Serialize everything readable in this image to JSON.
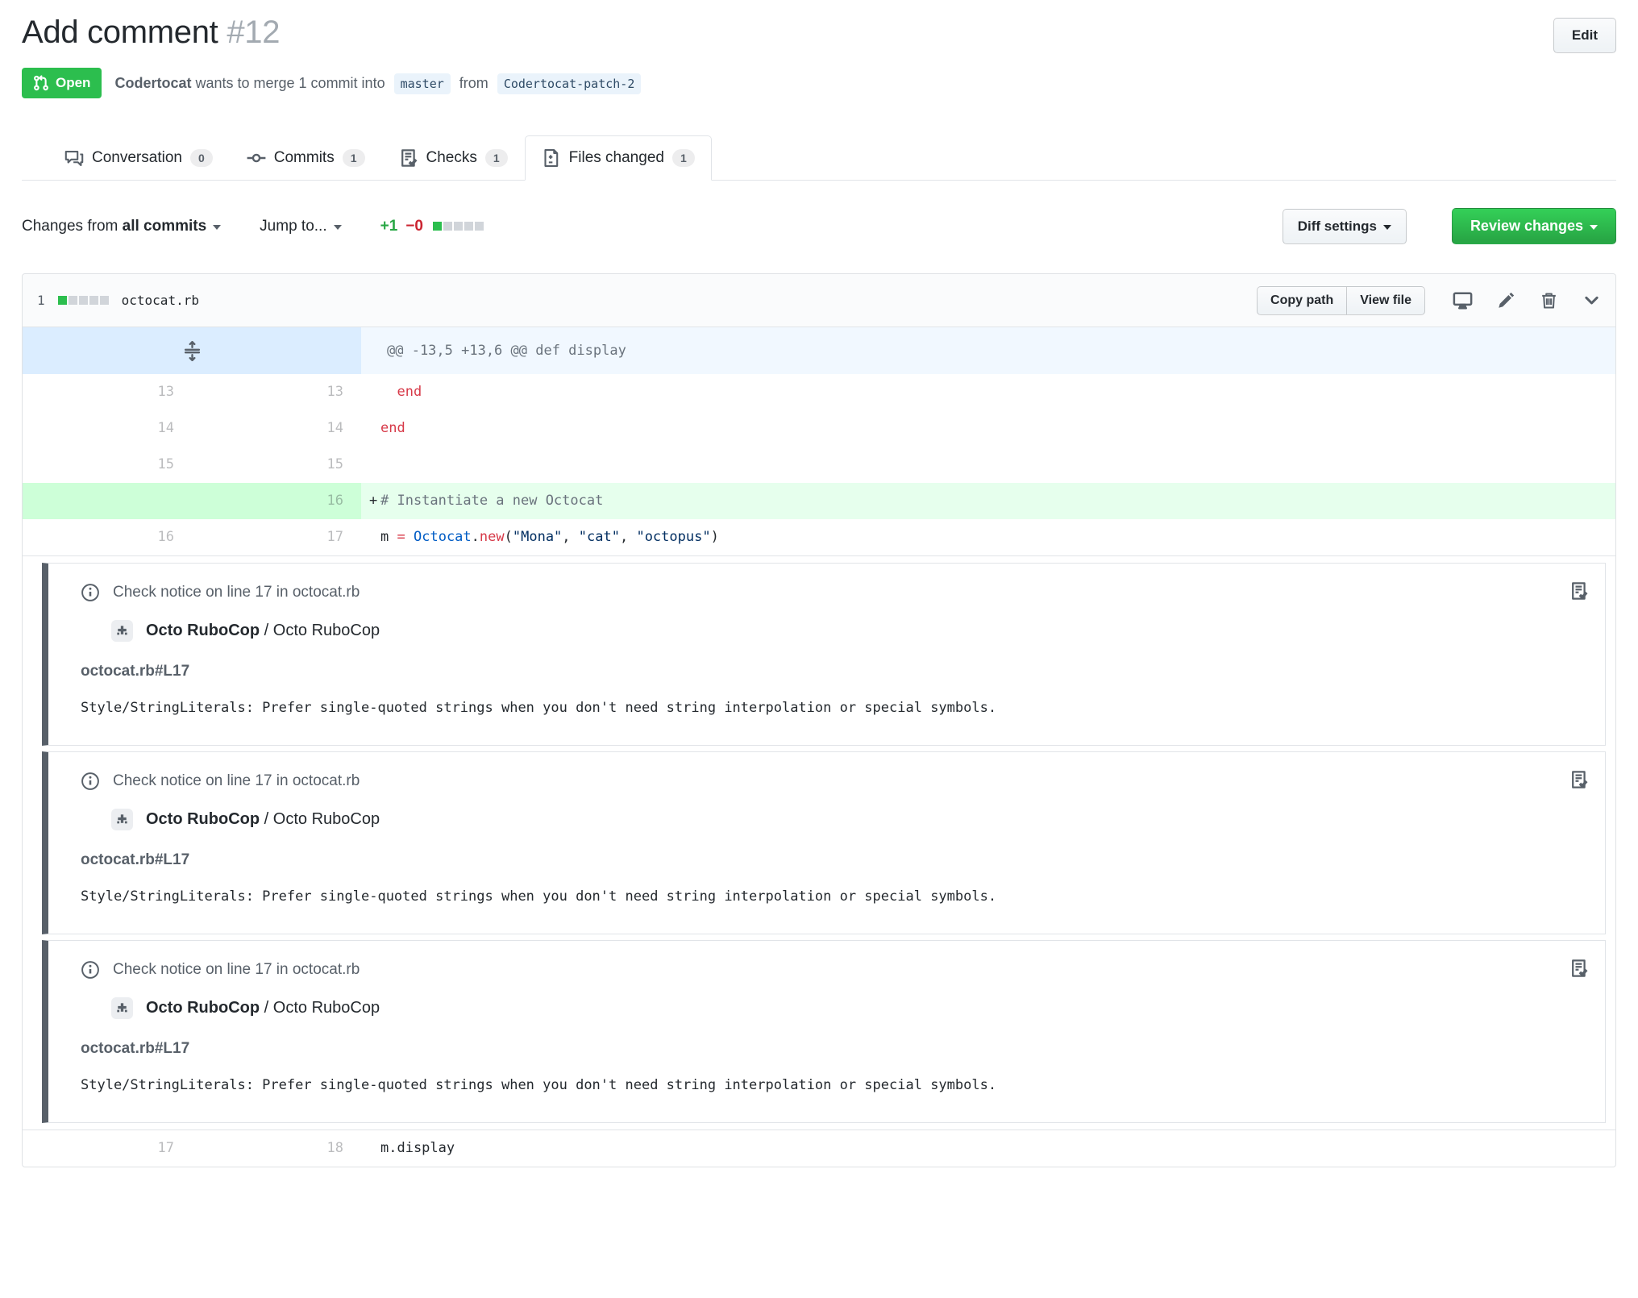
{
  "colors": {
    "open_state_green": "#2cbe4e",
    "review_button_green": "#28a745",
    "addition_green": "#28a745",
    "deletion_red": "#cb2431",
    "diffstat_neutral_gray": "#d1d5da",
    "hunk_gutter_blue": "#dbedff",
    "hunk_line_blue": "#f1f8ff",
    "added_gutter_green": "#cdffd8",
    "added_line_green": "#e6ffed",
    "annotation_bar_gray": "#586069",
    "branch_badge_bg": "#eaf3fb"
  },
  "header": {
    "title": "Add comment",
    "number": "#12",
    "edit_button": "Edit",
    "state": "Open",
    "author": "Codertocat",
    "merge_text": "wants to merge 1 commit into",
    "base_branch": "master",
    "from_text": "from",
    "head_branch": "Codertocat-patch-2"
  },
  "tabs": {
    "conversation": {
      "label": "Conversation",
      "count": "0"
    },
    "commits": {
      "label": "Commits",
      "count": "1"
    },
    "checks": {
      "label": "Checks",
      "count": "1"
    },
    "files": {
      "label": "Files changed",
      "count": "1"
    }
  },
  "toolbar": {
    "changes_from": "Changes from",
    "commit_range": "all commits",
    "jump_to": "Jump to...",
    "additions": "+1",
    "deletions": "−0",
    "diffstat_added_squares": 1,
    "diffstat_total_squares": 5,
    "diff_settings": "Diff settings",
    "review_changes": "Review changes"
  },
  "file": {
    "changed_count": "1",
    "name": "octocat.rb",
    "copy_path": "Copy path",
    "view_file": "View file",
    "diffstat_added_squares": 1,
    "diffstat_total_squares": 5
  },
  "diff": {
    "hunk": "@@ -13,5 +13,6 @@ def display",
    "rows": [
      {
        "old": "13",
        "new": "13",
        "code": "  end"
      },
      {
        "old": "14",
        "new": "14",
        "code": "end"
      },
      {
        "old": "15",
        "new": "15",
        "code": ""
      },
      {
        "old": "",
        "new": "16",
        "prefix": "+",
        "comment": "# Instantiate a new Octocat"
      },
      {
        "old": "16",
        "new": "17",
        "tokens": {
          "variable": "m",
          "operator": "=",
          "constant": "Octocat",
          "dot": ".",
          "method": "new",
          "open_paren": "(",
          "string1": "\"Mona\"",
          "comma1": ", ",
          "string2": "\"cat\"",
          "comma2": ", ",
          "string3": "\"octopus\"",
          "close_paren": ")"
        }
      },
      {
        "old": "17",
        "new": "18",
        "code": "m.display"
      }
    ]
  },
  "annotations": [
    {
      "header": "Check notice on line 17 in octocat.rb",
      "app_name": "Octo RuboCop",
      "separator": "/",
      "context_name": "Octo RuboCop",
      "location": "octocat.rb#L17",
      "message": "Style/StringLiterals: Prefer single-quoted strings when you don't need string interpolation or special symbols."
    },
    {
      "header": "Check notice on line 17 in octocat.rb",
      "app_name": "Octo RuboCop",
      "separator": "/",
      "context_name": "Octo RuboCop",
      "location": "octocat.rb#L17",
      "message": "Style/StringLiterals: Prefer single-quoted strings when you don't need string interpolation or special symbols."
    },
    {
      "header": "Check notice on line 17 in octocat.rb",
      "app_name": "Octo RuboCop",
      "separator": "/",
      "context_name": "Octo RuboCop",
      "location": "octocat.rb#L17",
      "message": "Style/StringLiterals: Prefer single-quoted strings when you don't need string interpolation or special symbols."
    }
  ]
}
